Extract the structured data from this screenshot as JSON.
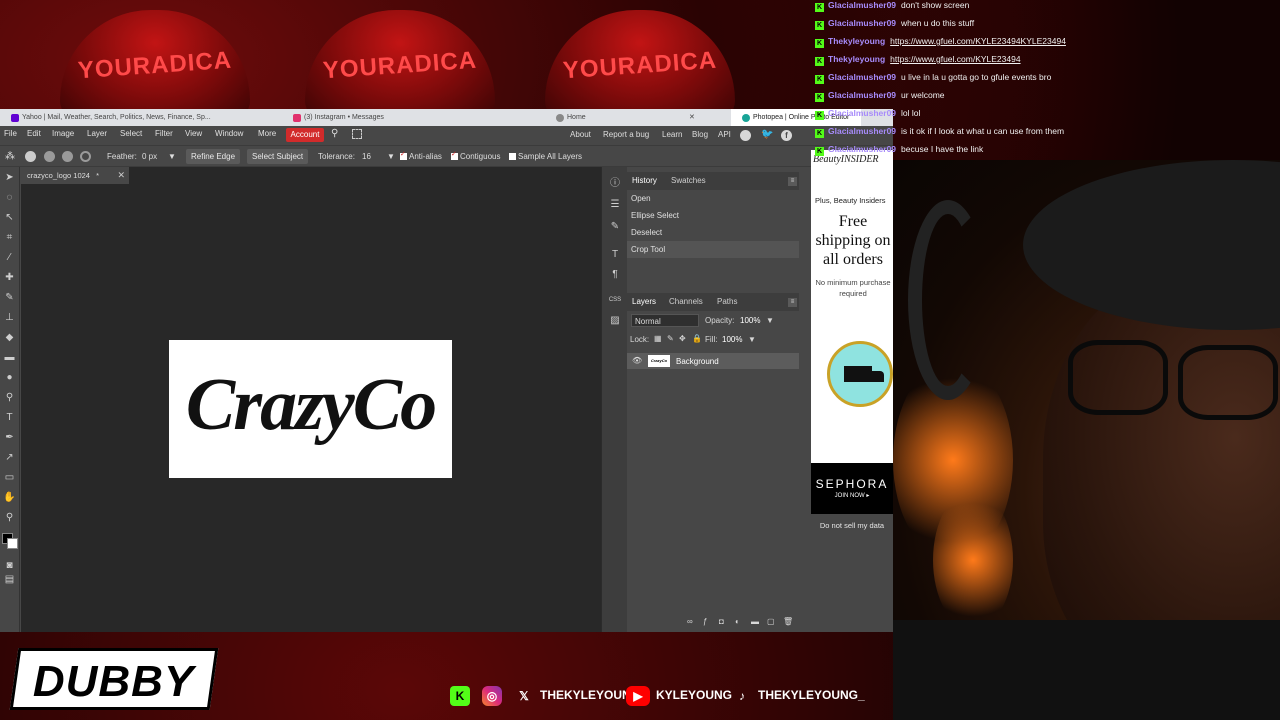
{
  "overlay": {
    "hat_text": "YOURADICA",
    "brand_name": "DUBBY",
    "socials": [
      {
        "icon": "kick-icon",
        "handle": ""
      },
      {
        "icon": "instagram-icon",
        "handle": ""
      },
      {
        "icon": "x-icon",
        "handle": "THEKYLEYOUNG"
      },
      {
        "icon": "youtube-icon",
        "handle": "KYLEYOUNG"
      },
      {
        "icon": "tiktok-icon",
        "handle": "THEKYLEYOUNG_"
      }
    ]
  },
  "browser": {
    "tabs": [
      {
        "label": "Yahoo | Mail, Weather, Search, Politics, News, Finance, Sp...",
        "color": "#6001d2"
      },
      {
        "label": "(3) Instagram • Messages",
        "color": "#e1306c"
      },
      {
        "label": "Home",
        "color": "#888888"
      },
      {
        "label": "Photopea | Online Photo Editor",
        "color": "#18a497"
      }
    ],
    "tab_close": "✕"
  },
  "photopea": {
    "menu": [
      "File",
      "Edit",
      "Image",
      "Layer",
      "Select",
      "Filter",
      "View",
      "Window",
      "More"
    ],
    "account_label": "Account",
    "links": [
      "About",
      "Report a bug",
      "Learn",
      "Blog",
      "API"
    ],
    "options": {
      "feather_label": "Feather:",
      "feather_value": "0 px",
      "refine_edge": "Refine Edge",
      "select_subject": "Select Subject",
      "tolerance_label": "Tolerance:",
      "tolerance_value": "16",
      "anti_alias": "Anti-alias",
      "contiguous": "Contiguous",
      "sample_all": "Sample All Layers"
    },
    "document_tab": "crazyco_logo 1024",
    "document_tab_mark": "*",
    "canvas_text": "CrazyCo",
    "history_panel": {
      "tabs": [
        "History",
        "Swatches"
      ],
      "items": [
        "Open",
        "Ellipse Select",
        "Deselect",
        "Crop Tool"
      ],
      "selected_index": 3
    },
    "layers_panel": {
      "tabs": [
        "Layers",
        "Channels",
        "Paths"
      ],
      "blend_mode": "Normal",
      "opacity_label": "Opacity:",
      "opacity_value": "100%",
      "lock_label": "Lock:",
      "fill_label": "Fill:",
      "fill_value": "100%",
      "layers": [
        {
          "name": "Background",
          "thumb_text": "CrazyCo"
        }
      ]
    },
    "strip_labels": [
      "CSS"
    ]
  },
  "ad": {
    "brand_banner": "BeautyINSIDER",
    "plus_line": "Plus, Beauty Insiders",
    "headline": "Free shipping on all orders",
    "sub": "No minimum purchase required",
    "logo": "SEPHORA",
    "cta": "JOIN NOW ▸",
    "privacy": "Do not sell my data"
  },
  "chat": {
    "messages": [
      {
        "user": "Glacialmusher09",
        "text": "don't show screen",
        "link": false
      },
      {
        "user": "Glacialmusher09",
        "text": "when u do this stuff",
        "link": false
      },
      {
        "user": "Thekyleyoung",
        "text": "https://www.gfuel.com/KYLE23494KYLE23494",
        "link": true
      },
      {
        "user": "Thekyleyoung",
        "text": "https://www.gfuel.com/KYLE23494",
        "link": true
      },
      {
        "user": "Glacialmusher09",
        "text": "u live in la u gotta go to gfule events bro",
        "link": false
      },
      {
        "user": "Glacialmusher09",
        "text": "ur welcome",
        "link": false
      },
      {
        "user": "Glacialmusher09",
        "text": "lol lol",
        "link": false
      },
      {
        "user": "Glacialmusher09",
        "text": "is it ok if I look at what u can use from them",
        "link": false
      },
      {
        "user": "Glacialmusher09",
        "text": "becuse I have the link",
        "link": false
      }
    ],
    "badge": "K"
  },
  "colors": {
    "accent": "#d22b2b",
    "kick_green": "#53fc18",
    "chat_username": "#a78bfa"
  }
}
